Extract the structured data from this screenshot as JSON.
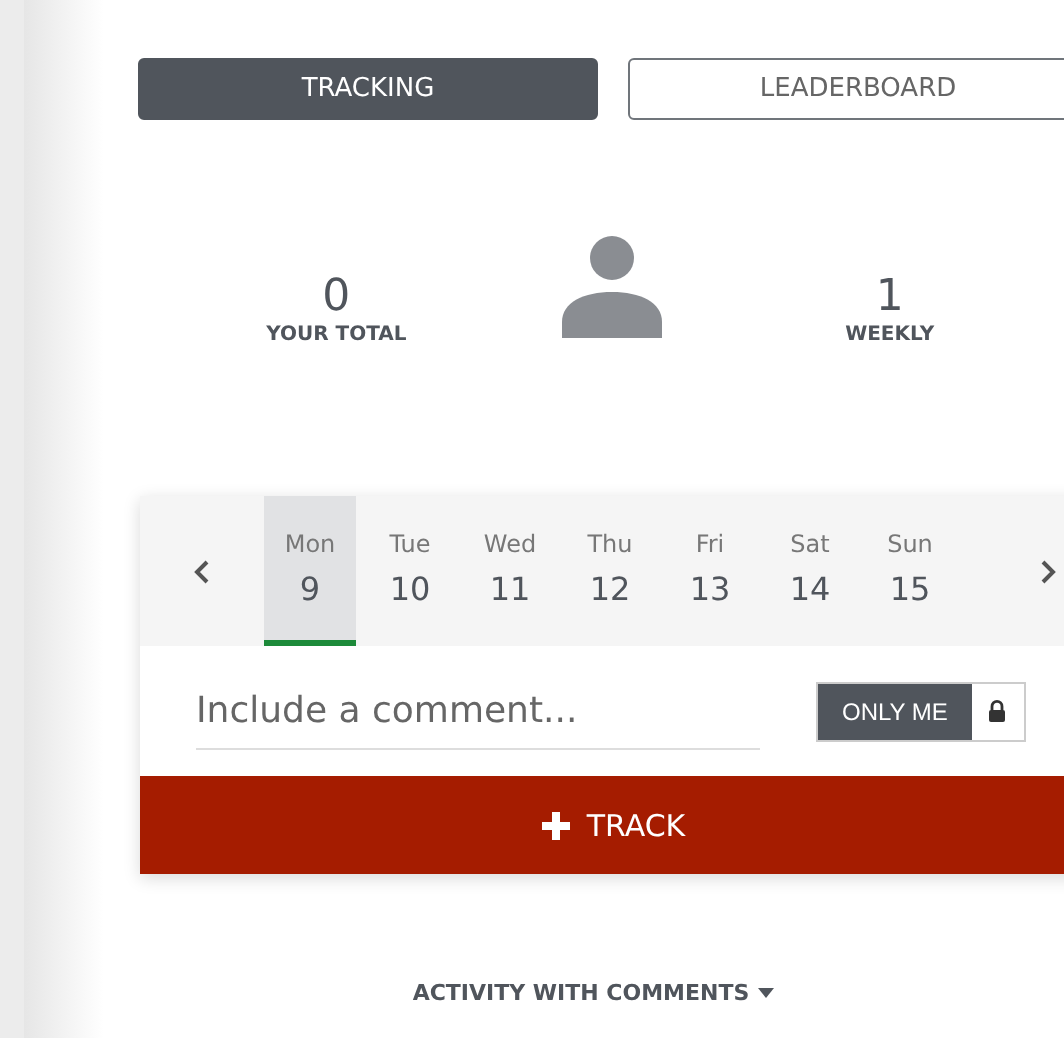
{
  "tabs": [
    {
      "label": "TRACKING",
      "selected": true
    },
    {
      "label": "LEADERBOARD",
      "selected": false
    }
  ],
  "stats": [
    {
      "value": "0",
      "label": "YOUR TOTAL"
    },
    {
      "value": "1",
      "label": "WEEKLY"
    }
  ],
  "days": [
    {
      "weekday": "Mon",
      "date": "9",
      "selected": true
    },
    {
      "weekday": "Tue",
      "date": "10",
      "selected": false
    },
    {
      "weekday": "Wed",
      "date": "11",
      "selected": false
    },
    {
      "weekday": "Thu",
      "date": "12",
      "selected": false
    },
    {
      "weekday": "Fri",
      "date": "13",
      "selected": false
    },
    {
      "weekday": "Sat",
      "date": "14",
      "selected": false
    },
    {
      "weekday": "Sun",
      "date": "15",
      "selected": false
    }
  ],
  "comment": {
    "placeholder": "Include a comment..."
  },
  "visibility": {
    "label": "ONLY ME"
  },
  "track_button": {
    "label": "TRACK"
  },
  "filter": {
    "label": "ACTIVITY WITH COMMENTS"
  }
}
